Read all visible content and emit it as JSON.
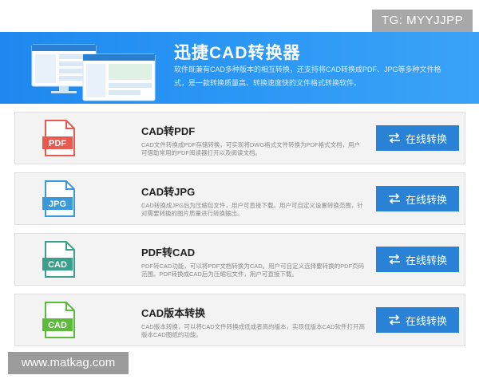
{
  "tg_badge": "TG: MYYJJPP",
  "banner": {
    "title": "迅捷CAD转换器",
    "description": "软件既兼有CAD多种版本的相互转换，还支持将CAD转换成PDF、JPG等多种文件格式，是一款转换质量高、转换速度快的文件格式转换软件。"
  },
  "cards": [
    {
      "icon_text": "PDF",
      "icon_color": "#e85a4f",
      "title": "CAD转PDF",
      "description": "CAD文件转换成PDF存储转换，可实现将DWG格式文件转换为PDF格式文档，用户可借助常用的PDF阅读器打开以及阅读文档。",
      "button_label": "在线转换"
    },
    {
      "icon_text": "JPG",
      "icon_color": "#3a9ad9",
      "title": "CAD转JPG",
      "description": "CAD转换成JPG后为压缩包文件，用户可直接下载。用户可自定义设置转换范围，针对需要转换的图片质量进行转换输出。",
      "button_label": "在线转换"
    },
    {
      "icon_text": "CAD",
      "icon_color": "#3aa08c",
      "title": "PDF转CAD",
      "description": "PDF转CAD功能，可以将PDF文档转换为CAD。用户可自定义选择要转换的PDF页码范围。PDF转换成CAD后为压缩包文件，用户可直接下载。",
      "button_label": "在线转换"
    },
    {
      "icon_text": "CAD",
      "icon_color": "#5bbb3a",
      "title": "CAD版本转换",
      "description": "CAD版本转换，可以将CAD文件转换成低或者高的版本，实现低版本CAD软件打开高版本CAD图纸的功能。",
      "button_label": "在线转换"
    }
  ],
  "watermark": "www.matkag.com"
}
